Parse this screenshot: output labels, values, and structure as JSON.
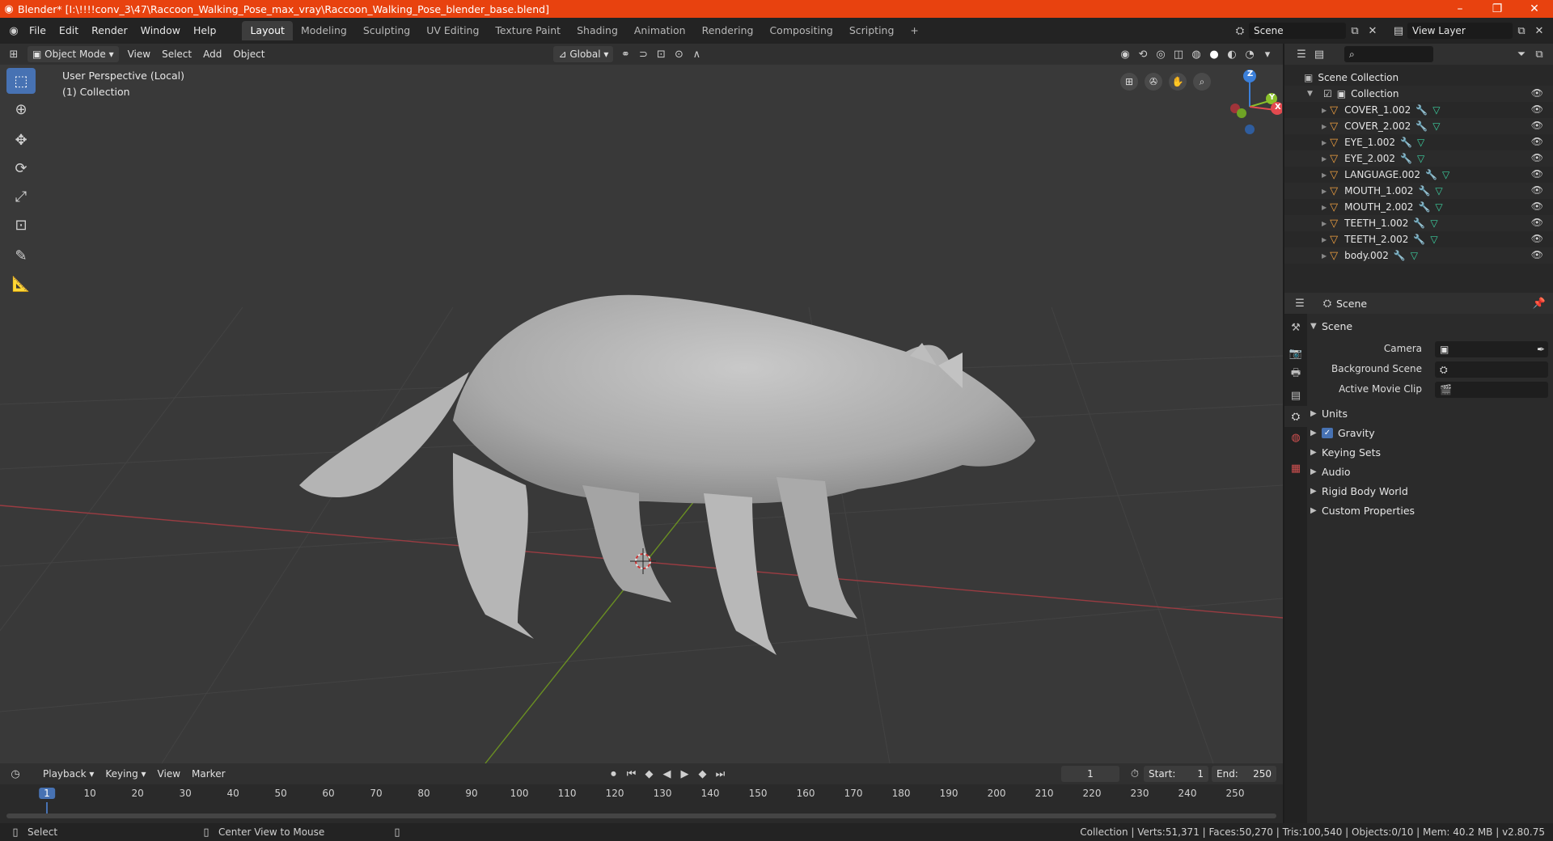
{
  "window": {
    "title": "Blender* [I:\\!!!!conv_3\\47\\Raccoon_Walking_Pose_max_vray\\Raccoon_Walking_Pose_blender_base.blend]",
    "minimize": "–",
    "maximize": "❐",
    "close": "✕"
  },
  "menu": [
    "File",
    "Edit",
    "Render",
    "Window",
    "Help"
  ],
  "workspaces": [
    "Layout",
    "Modeling",
    "Sculpting",
    "UV Editing",
    "Texture Paint",
    "Shading",
    "Animation",
    "Rendering",
    "Compositing",
    "Scripting"
  ],
  "workspace_add": "+",
  "scene": {
    "name": "Scene"
  },
  "view_layer": {
    "name": "View Layer"
  },
  "viewport_header": {
    "mode": "Object Mode",
    "view": "View",
    "select": "Select",
    "add": "Add",
    "object": "Object",
    "orientation": "Global"
  },
  "viewport": {
    "perspective": "User Perspective (Local)",
    "collection": "(1) Collection"
  },
  "gizmo": {
    "z": "Z",
    "y": "Y",
    "x": "X"
  },
  "outliner": {
    "scene_collection": "Scene Collection",
    "collection": "Collection",
    "items": [
      "COVER_1.002",
      "COVER_2.002",
      "EYE_1.002",
      "EYE_2.002",
      "LANGUAGE.002",
      "MOUTH_1.002",
      "MOUTH_2.002",
      "TEETH_1.002",
      "TEETH_2.002",
      "body.002"
    ]
  },
  "properties": {
    "context": "Scene",
    "panel": "Scene",
    "camera_label": "Camera",
    "bg_scene_label": "Background Scene",
    "movie_clip_label": "Active Movie Clip",
    "sections": [
      "Units",
      "Gravity",
      "Keying Sets",
      "Audio",
      "Rigid Body World",
      "Custom Properties"
    ]
  },
  "timeline": {
    "playback": "Playback",
    "keying": "Keying",
    "view": "View",
    "marker": "Marker",
    "current_frame": "1",
    "start_label": "Start:",
    "start": "1",
    "end_label": "End:",
    "end": "250",
    "ticks": [
      "1",
      "10",
      "20",
      "30",
      "40",
      "50",
      "60",
      "70",
      "80",
      "90",
      "100",
      "110",
      "120",
      "130",
      "140",
      "150",
      "160",
      "170",
      "180",
      "190",
      "200",
      "210",
      "220",
      "230",
      "240",
      "250"
    ]
  },
  "status": {
    "left": "Select",
    "middle": "Center View to Mouse",
    "right": "Collection | Verts:51,371 | Faces:50,270 | Tris:100,540 | Objects:0/10 | Mem: 40.2 MB | v2.80.75"
  },
  "colors": {
    "titlebar": "#e8420f",
    "accent": "#4772b3",
    "viewport_bg": "#393939",
    "axis_x": "#b0393f",
    "axis_y": "#6a8f22"
  }
}
